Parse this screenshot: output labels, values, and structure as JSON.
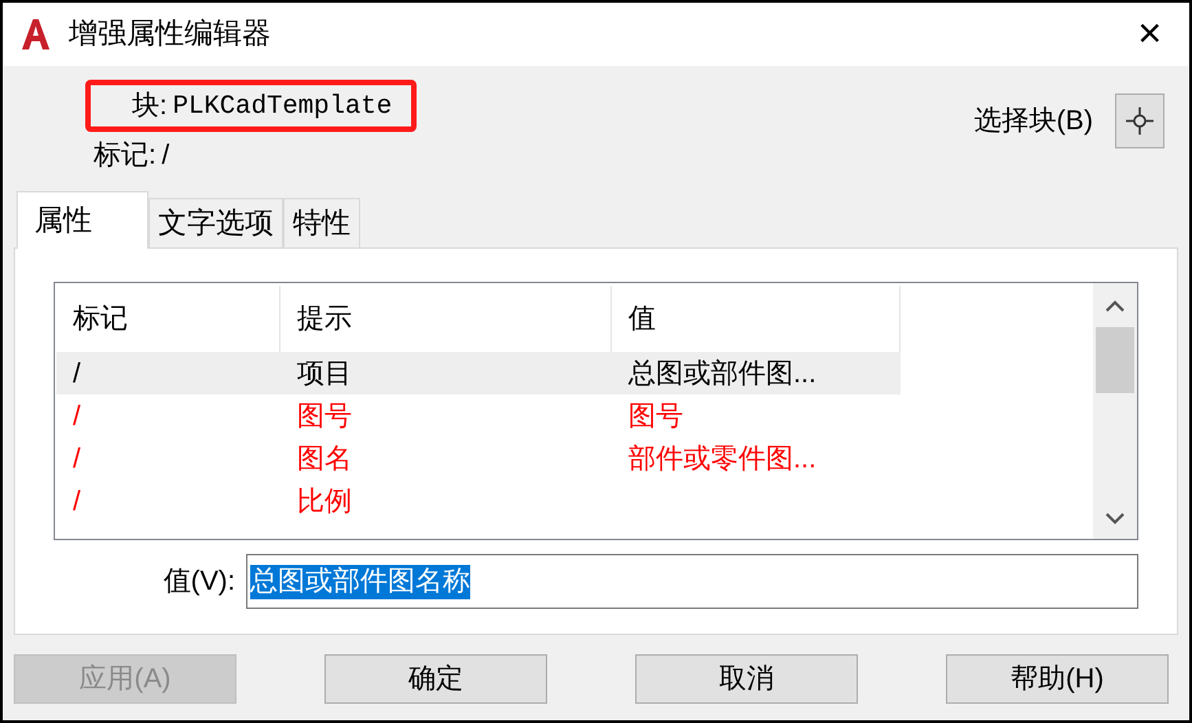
{
  "window": {
    "title": "增强属性编辑器",
    "close": "×"
  },
  "block": {
    "label": "块:",
    "value": "PLKCadTemplate",
    "highlighted": true
  },
  "tag": {
    "label": "标记:",
    "value": "/"
  },
  "select_block": {
    "label": "选择块(B)"
  },
  "tabs": [
    {
      "label": "属性",
      "selected": true
    },
    {
      "label": "文字选项",
      "selected": false
    },
    {
      "label": "特性",
      "selected": false
    }
  ],
  "table": {
    "columns": [
      "标记",
      "提示",
      "值"
    ],
    "rows": [
      {
        "cells": [
          "/",
          "项目",
          "总图或部件图..."
        ],
        "selected": true,
        "color": "#000000"
      },
      {
        "cells": [
          "/",
          "图号",
          "图号"
        ],
        "selected": false,
        "color": "#ff0000"
      },
      {
        "cells": [
          "/",
          "图名",
          "部件或零件图..."
        ],
        "selected": false,
        "color": "#ff0000"
      },
      {
        "cells": [
          "/",
          "比例",
          ""
        ],
        "selected": false,
        "color": "#ff0000"
      }
    ]
  },
  "value_field": {
    "label": "值(V):",
    "value": "总图或部件图名称"
  },
  "buttons": [
    {
      "label": "应用(A)",
      "disabled": true
    },
    {
      "label": "确定",
      "disabled": false
    },
    {
      "label": "取消",
      "disabled": false
    },
    {
      "label": "帮助(H)",
      "disabled": false
    }
  ]
}
